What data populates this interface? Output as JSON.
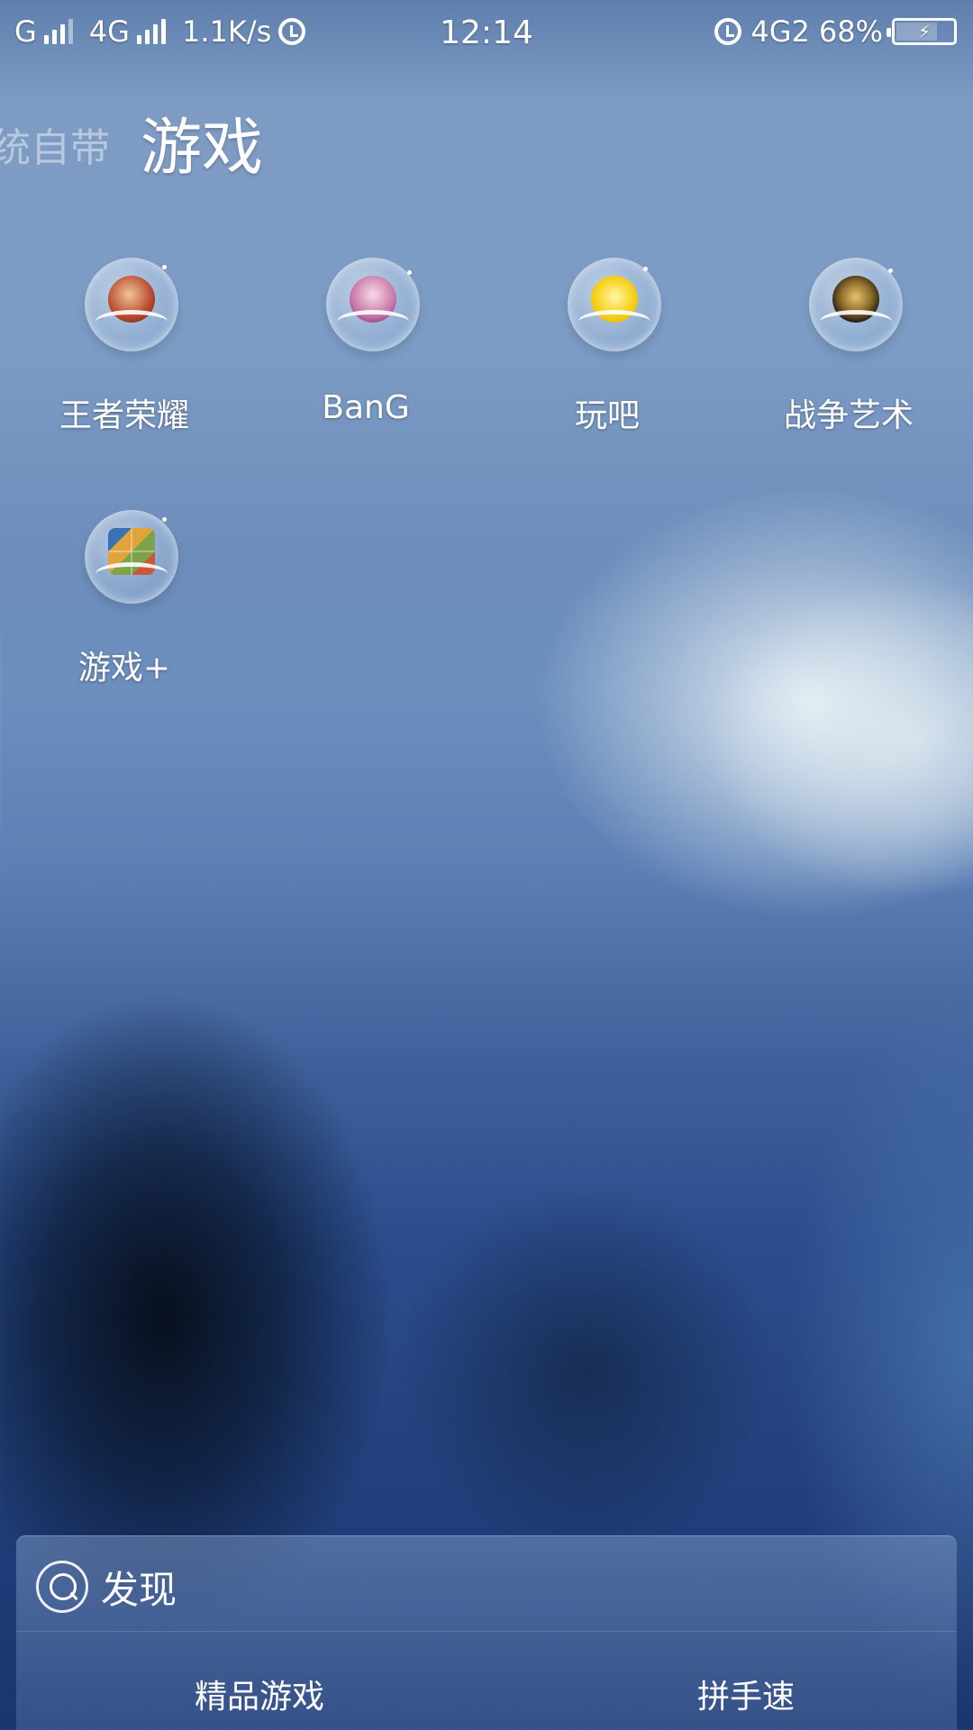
{
  "status_bar": {
    "sim1": "G",
    "sim2": "4G",
    "net_speed": "1.1K/s",
    "time": "12:14",
    "net_type_right": "4G2",
    "battery": "68%",
    "battery_level": 0.68,
    "icons": [
      "signal-icon",
      "alarm-icon",
      "battery-charging-icon"
    ]
  },
  "folder": {
    "prev_title": "统自带",
    "title": "游戏"
  },
  "apps": [
    {
      "label": "王者荣耀",
      "icon": "honor-of-kings-icon",
      "color": "#c9573a"
    },
    {
      "label": "BanG",
      "icon": "bang-dream-icon",
      "color": "#c874a8"
    },
    {
      "label": "玩吧",
      "icon": "wanba-icon",
      "color": "#f6d11a"
    },
    {
      "label": "战争艺术",
      "icon": "art-of-war-icon",
      "color": "#1f1a12"
    },
    {
      "label": "游戏+",
      "icon": "game-plus-icon",
      "color": "#7ca34a"
    }
  ],
  "discover": {
    "label": "发现",
    "tabs": [
      "精品游戏",
      "拼手速"
    ]
  }
}
